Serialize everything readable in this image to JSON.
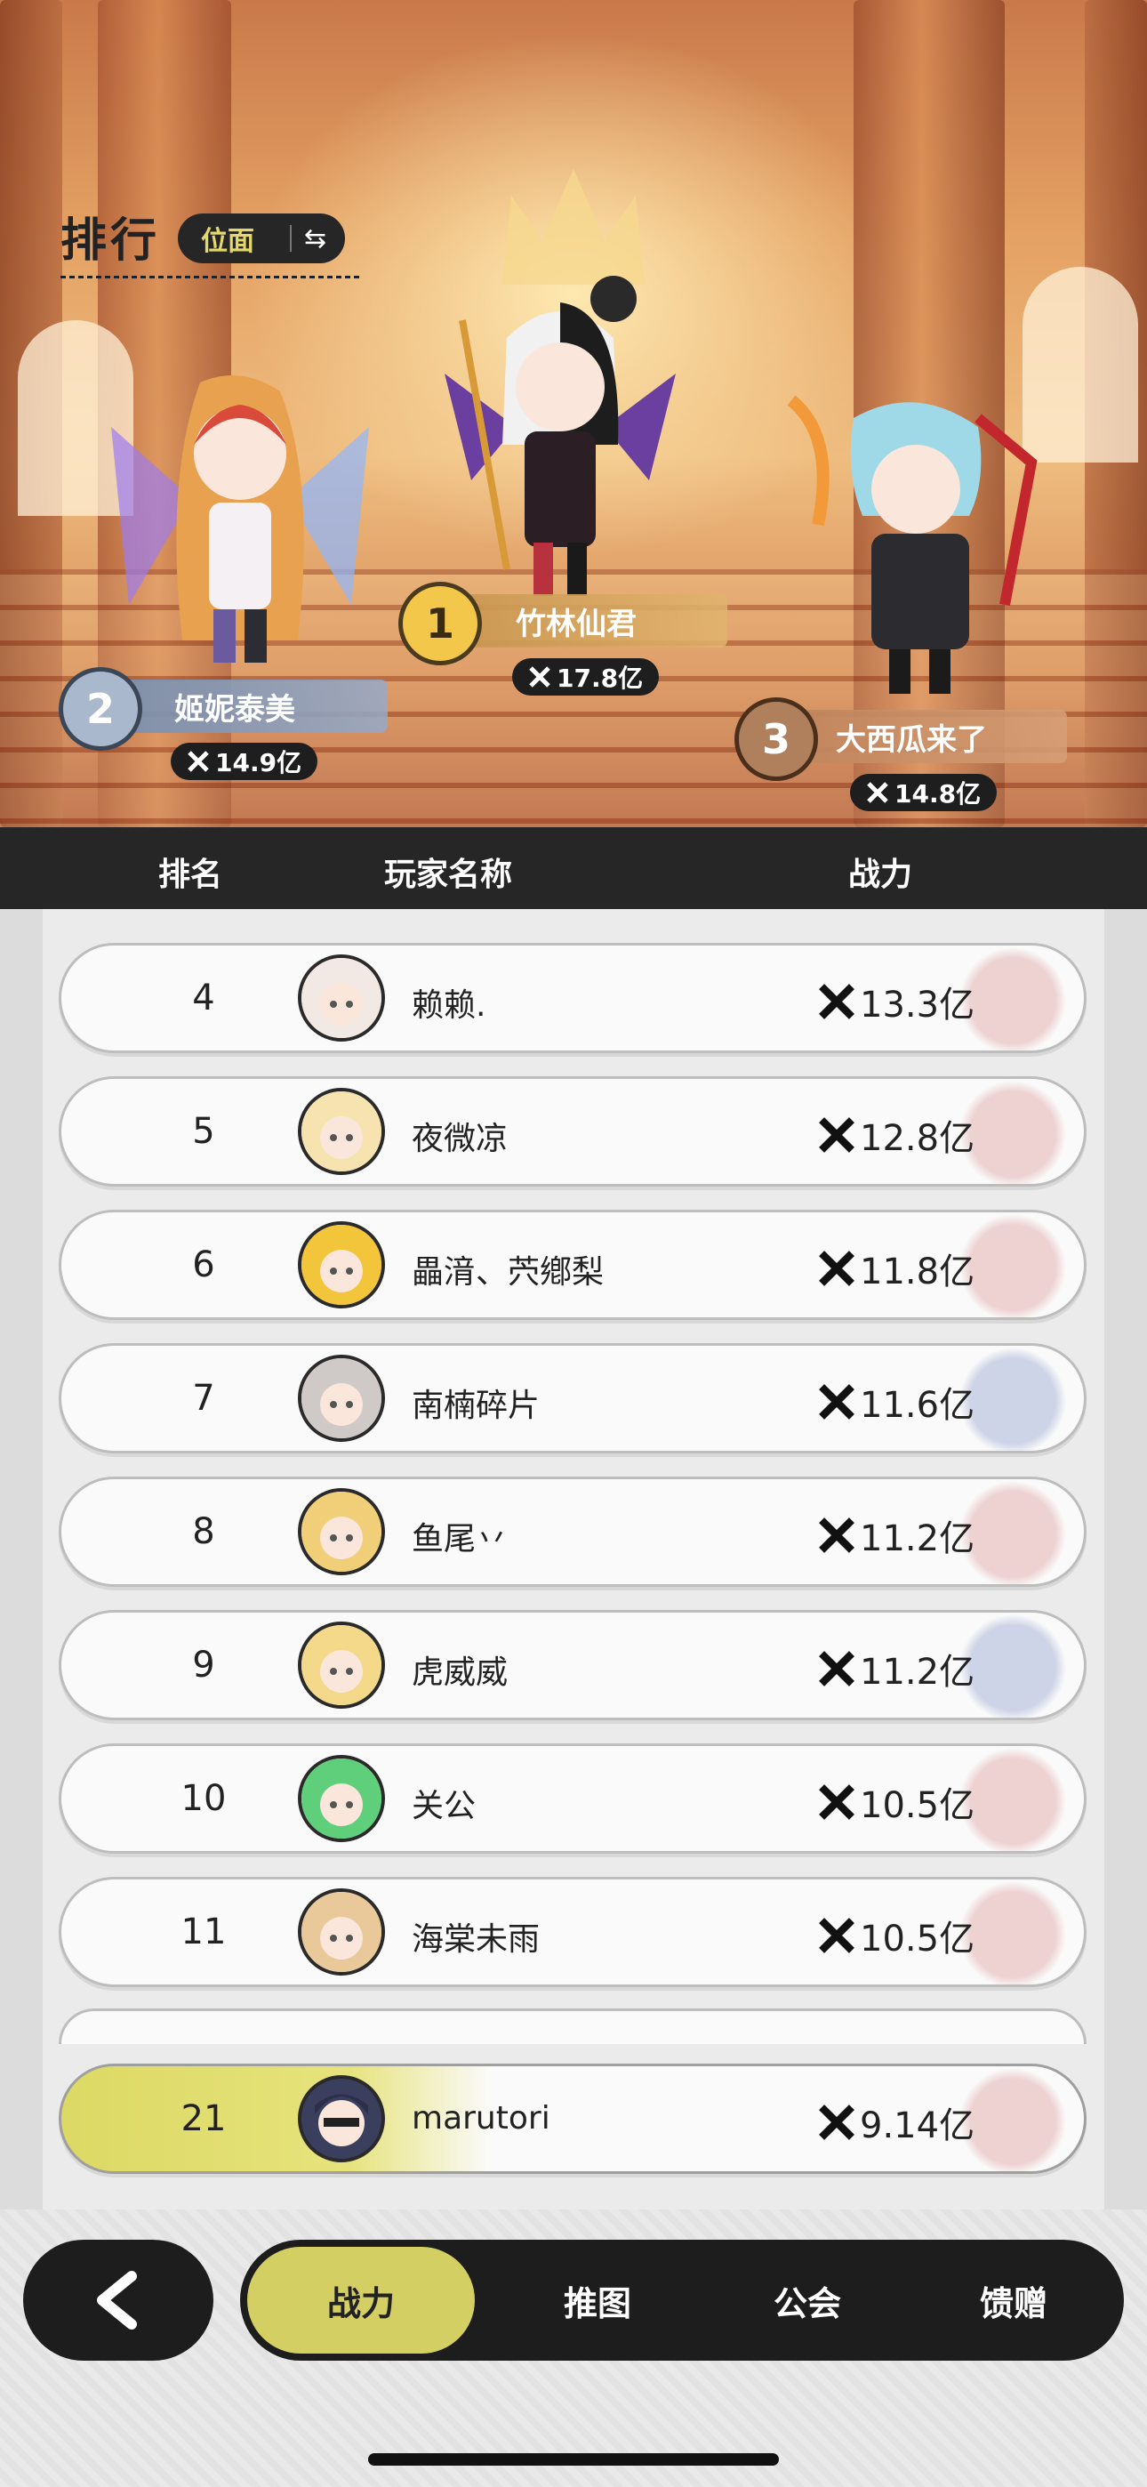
{
  "header": {
    "title": "排行",
    "realm_label": "位面",
    "swap_icon": "swap-icon"
  },
  "podium": [
    {
      "place": "1",
      "name": "竹林仙君",
      "power": "17.8亿"
    },
    {
      "place": "2",
      "name": "姬妮泰美",
      "power": "14.9亿"
    },
    {
      "place": "3",
      "name": "大西瓜来了",
      "power": "14.8亿"
    }
  ],
  "table": {
    "columns": [
      "排名",
      "玩家名称",
      "战力"
    ]
  },
  "rows": [
    {
      "rank": "4",
      "name": "赖赖.",
      "power": "13.3亿",
      "emblem": "red",
      "avatar_color": "#f2e9e5"
    },
    {
      "rank": "5",
      "name": "夜微凉",
      "power": "12.8亿",
      "emblem": "red",
      "avatar_color": "#f7e3b0"
    },
    {
      "rank": "6",
      "name": "畾湇、茓鄕梨",
      "power": "11.8亿",
      "emblem": "red",
      "avatar_color": "#f3c53a"
    },
    {
      "rank": "7",
      "name": "南楠碎片",
      "power": "11.6亿",
      "emblem": "blue",
      "avatar_color": "#cfcac7"
    },
    {
      "rank": "8",
      "name": "鱼尾丷",
      "power": "11.2亿",
      "emblem": "red",
      "avatar_color": "#f0cf78"
    },
    {
      "rank": "9",
      "name": "虎威威",
      "power": "11.2亿",
      "emblem": "blue",
      "avatar_color": "#f4d98a"
    },
    {
      "rank": "10",
      "name": "关公",
      "power": "10.5亿",
      "emblem": "red",
      "avatar_color": "#5fcf7c"
    },
    {
      "rank": "11",
      "name": "海棠未雨",
      "power": "10.5亿",
      "emblem": "red",
      "avatar_color": "#e9c99a"
    }
  ],
  "me": {
    "rank": "21",
    "name": "marutori",
    "power": "9.14亿",
    "avatar_color": "#3a3f5e"
  },
  "nav": {
    "back_icon": "back-arrow-icon",
    "tabs": [
      "战力",
      "推图",
      "公会",
      "馈赠"
    ],
    "active_tab": "战力",
    "accent": "#d3cf63"
  }
}
